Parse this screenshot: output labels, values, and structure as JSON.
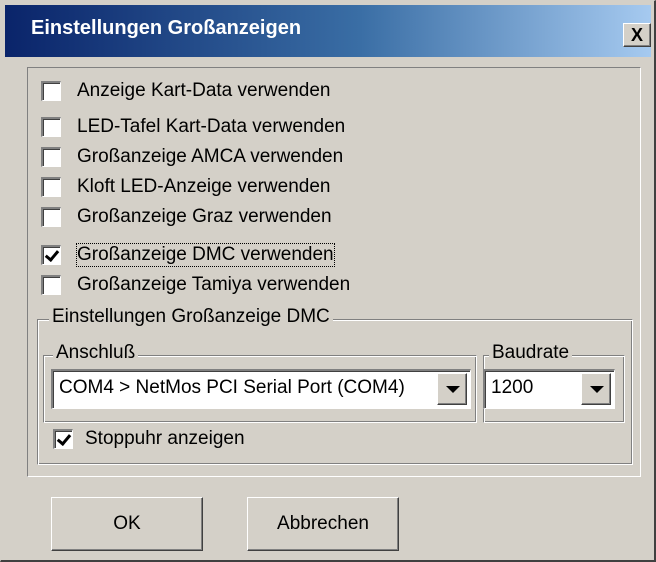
{
  "window": {
    "title": "Einstellungen Großanzeigen",
    "close_label": "X"
  },
  "options": [
    {
      "label": "Anzeige Kart-Data verwenden",
      "checked": false
    },
    {
      "label": "LED-Tafel Kart-Data verwenden",
      "checked": false
    },
    {
      "label": "Großanzeige AMCA verwenden",
      "checked": false
    },
    {
      "label": "Kloft LED-Anzeige verwenden",
      "checked": false
    },
    {
      "label": "Großanzeige Graz verwenden",
      "checked": false
    },
    {
      "label": "Großanzeige DMC verwenden",
      "checked": true
    },
    {
      "label": "Großanzeige Tamiya verwenden",
      "checked": false
    }
  ],
  "dmc_group": {
    "title": "Einstellungen Großanzeige DMC",
    "port": {
      "legend": "Anschluß",
      "value": "COM4  > NetMos PCI Serial Port (COM4)"
    },
    "baud": {
      "legend": "Baudrate",
      "value": "1200"
    },
    "stopwatch": {
      "label": "Stoppuhr anzeigen",
      "checked": true
    }
  },
  "buttons": {
    "ok_label": "OK",
    "cancel_label": "Abbrechen"
  }
}
